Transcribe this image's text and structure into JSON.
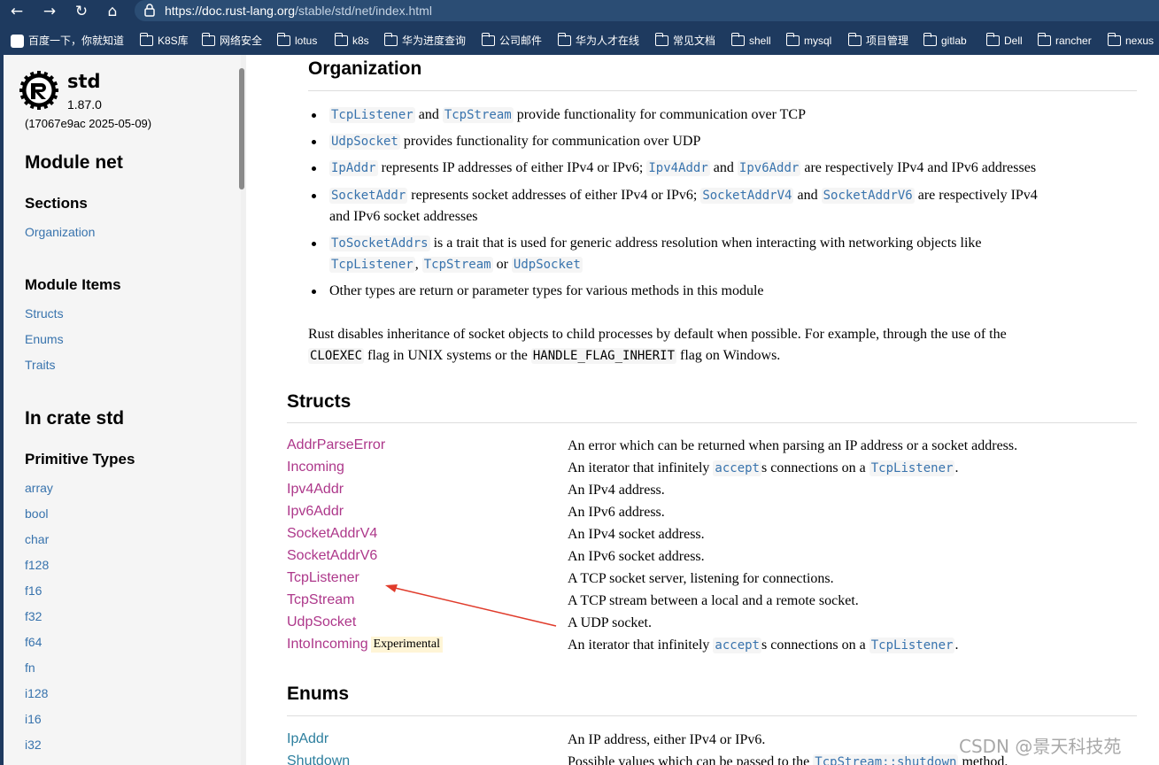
{
  "browser": {
    "url_host": "https://doc.rust-lang.org",
    "url_path": "/stable/std/net/index.html",
    "bookmarks": [
      "百度一下，你就知道",
      "K8S库",
      "网络安全",
      "lotus",
      "k8s",
      "华为进度查询",
      "公司邮件",
      "华为人才在线",
      "常见文档",
      "shell",
      "mysql",
      "项目管理",
      "gitlab",
      "Dell",
      "rancher",
      "nexus"
    ]
  },
  "sidebar": {
    "crate_name": "std",
    "version": "1.87.0",
    "build": "(17067e9ac 2025-05-09)",
    "module_title": "Module net",
    "sections_heading": "Sections",
    "sections": [
      "Organization"
    ],
    "module_items_heading": "Module Items",
    "module_items": [
      "Structs",
      "Enums",
      "Traits"
    ],
    "crate_heading": "In crate std",
    "primitive_heading": "Primitive Types",
    "primitives": [
      "array",
      "bool",
      "char",
      "f128",
      "f16",
      "f32",
      "f64",
      "fn",
      "i128",
      "i16",
      "i32"
    ]
  },
  "main": {
    "organization_heading": "Organization",
    "bullets": [
      [
        {
          "c": "TcpListener"
        },
        {
          "t": " and "
        },
        {
          "c": "TcpStream"
        },
        {
          "t": " provide functionality for communication over TCP"
        }
      ],
      [
        {
          "c": "UdpSocket"
        },
        {
          "t": " provides functionality for communication over UDP"
        }
      ],
      [
        {
          "c": "IpAddr"
        },
        {
          "t": " represents IP addresses of either IPv4 or IPv6; "
        },
        {
          "c": "Ipv4Addr"
        },
        {
          "t": " and "
        },
        {
          "c": "Ipv6Addr"
        },
        {
          "t": " are respectively IPv4 and IPv6 addresses"
        }
      ],
      [
        {
          "c": "SocketAddr"
        },
        {
          "t": " represents socket addresses of either IPv4 or IPv6; "
        },
        {
          "c": "SocketAddrV4"
        },
        {
          "t": " and "
        },
        {
          "c": "SocketAddrV6"
        },
        {
          "t": " are respectively IPv4"
        },
        {
          "br": true
        },
        {
          "t": "and IPv6 socket addresses"
        }
      ],
      [
        {
          "c": "ToSocketAddrs"
        },
        {
          "t": " is a trait that is used for generic address resolution when interacting with networking objects like"
        },
        {
          "br": true
        },
        {
          "c": "TcpListener"
        },
        {
          "t": ", "
        },
        {
          "c": "TcpStream"
        },
        {
          "t": " or "
        },
        {
          "c": "UdpSocket"
        }
      ],
      [
        {
          "t": "Other types are return or parameter types for various methods in this module"
        }
      ]
    ],
    "paragraph": [
      {
        "t": "Rust disables inheritance of socket objects to child processes by default when possible. For example, through the use of the"
      },
      {
        "br": true
      },
      {
        "k": "CLOEXEC"
      },
      {
        "t": " flag in UNIX systems or the "
      },
      {
        "k": "HANDLE_FLAG_INHERIT"
      },
      {
        "t": " flag on Windows."
      }
    ],
    "structs_heading": "Structs",
    "structs": [
      {
        "name": "AddrParseError",
        "desc": [
          {
            "t": "An error which can be returned when parsing an IP address or a socket address."
          }
        ]
      },
      {
        "name": "Incoming",
        "desc": [
          {
            "t": "An iterator that infinitely "
          },
          {
            "c": "accept"
          },
          {
            "t": "s connections on a "
          },
          {
            "c": "TcpListener"
          },
          {
            "t": "."
          }
        ]
      },
      {
        "name": "Ipv4Addr",
        "desc": [
          {
            "t": "An IPv4 address."
          }
        ]
      },
      {
        "name": "Ipv6Addr",
        "desc": [
          {
            "t": "An IPv6 address."
          }
        ]
      },
      {
        "name": "SocketAddrV4",
        "desc": [
          {
            "t": "An IPv4 socket address."
          }
        ]
      },
      {
        "name": "SocketAddrV6",
        "desc": [
          {
            "t": "An IPv6 socket address."
          }
        ]
      },
      {
        "name": "TcpListener",
        "desc": [
          {
            "t": "A TCP socket server, listening for connections."
          }
        ]
      },
      {
        "name": "TcpStream",
        "desc": [
          {
            "t": "A TCP stream between a local and a remote socket."
          }
        ]
      },
      {
        "name": "UdpSocket",
        "desc": [
          {
            "t": "A UDP socket."
          }
        ]
      },
      {
        "name": "IntoIncoming",
        "badge": "Experimental",
        "desc": [
          {
            "t": "An iterator that infinitely "
          },
          {
            "c": "accept"
          },
          {
            "t": "s connections on a "
          },
          {
            "c": "TcpListener"
          },
          {
            "t": "."
          }
        ]
      }
    ],
    "enums_heading": "Enums",
    "enums": [
      {
        "name": "IpAddr",
        "desc": [
          {
            "t": "An IP address, either IPv4 or IPv6."
          }
        ]
      },
      {
        "name": "Shutdown",
        "desc": [
          {
            "t": "Possible values which can be passed to the "
          },
          {
            "c": "TcpStream::shutdown"
          },
          {
            "t": " method."
          }
        ]
      }
    ]
  },
  "watermark": "CSDN @景天科技苑",
  "colors": {
    "struct_link": "#ad378a",
    "enum_link": "#2d7f9e",
    "code_link": "#3873ad",
    "annotation_arrow": "#e03b2b"
  }
}
